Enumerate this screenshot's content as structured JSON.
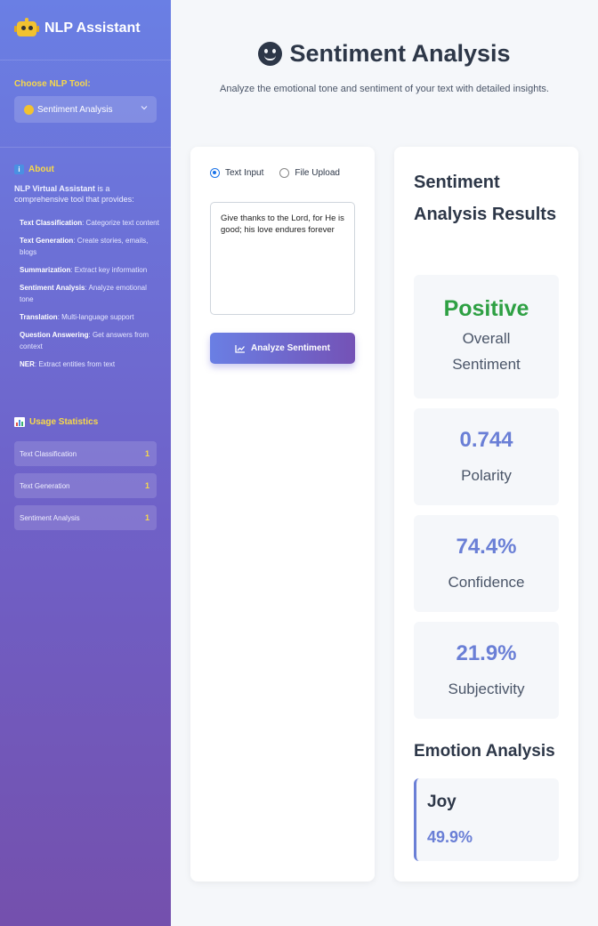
{
  "sidebar": {
    "app_title": "NLP Assistant",
    "choose_label": "Choose NLP Tool:",
    "selected_tool": "Sentiment Analysis",
    "about_title": "About",
    "about_intro_bold": "NLP Virtual Assistant",
    "about_intro_rest": " is a comprehensive tool that provides:",
    "features": [
      {
        "name": "Text Classification",
        "desc": ": Categorize text content"
      },
      {
        "name": "Text Generation",
        "desc": ": Create stories, emails, blogs"
      },
      {
        "name": "Summarization",
        "desc": ": Extract key information"
      },
      {
        "name": "Sentiment Analysis",
        "desc": ": Analyze emotional tone"
      },
      {
        "name": "Translation",
        "desc": ": Multi-language support"
      },
      {
        "name": "Question Answering",
        "desc": ": Get answers from context"
      },
      {
        "name": "NER",
        "desc": ": Extract entities from text"
      }
    ],
    "stats_title": "Usage Statistics",
    "stats": [
      {
        "name": "Text Classification",
        "count": "1"
      },
      {
        "name": "Text Generation",
        "count": "1"
      },
      {
        "name": "Sentiment Analysis",
        "count": "1"
      }
    ]
  },
  "main": {
    "title": "Sentiment Analysis",
    "subtitle": "Analyze the emotional tone and sentiment of your text with detailed insights.",
    "input_modes": [
      "Text Input",
      "File Upload"
    ],
    "selected_mode": "Text Input",
    "input_text": "Give thanks to the Lord, for He is good; his love endures forever",
    "analyze_button": "Analyze Sentiment"
  },
  "results": {
    "title": "Sentiment Analysis Results",
    "overall_value": "Positive",
    "overall_label": "Overall Sentiment",
    "polarity_value": "0.744",
    "polarity_label": "Polarity",
    "confidence_value": "74.4%",
    "confidence_label": "Confidence",
    "subjectivity_value": "21.9%",
    "subjectivity_label": "Subjectivity",
    "emotion_title": "Emotion Analysis",
    "emotion_name": "Joy",
    "emotion_pct": "49.9%"
  },
  "colors": {
    "accent": "#6a7fd6",
    "positive": "#2ea043",
    "highlight": "#f7d84a"
  }
}
